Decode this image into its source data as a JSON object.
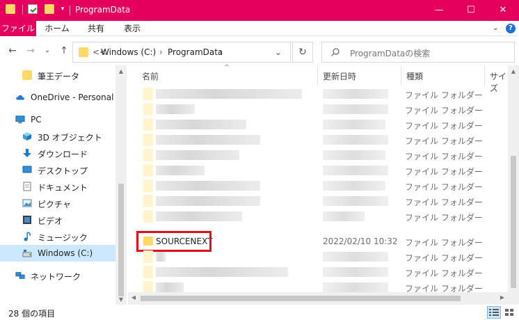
{
  "window": {
    "title": "ProgramData",
    "minimize": "—",
    "maximize": "☐",
    "close": "✕",
    "quick_access_dropdown": "▾"
  },
  "ribbon": {
    "tabs": [
      "ファイル",
      "ホーム",
      "共有",
      "表示"
    ],
    "expand": "⌄",
    "help": "?"
  },
  "address": {
    "back": "←",
    "forward": "→",
    "recent": "⌄",
    "up": "↑",
    "overflow": "<<",
    "segments": [
      "Windows (C:)",
      "ProgramData"
    ],
    "separator": "›",
    "dropdown": "⌄",
    "refresh": "↻"
  },
  "search": {
    "placeholder": "ProgramDataの検索"
  },
  "navpane": {
    "items": [
      {
        "label": "筆王データ",
        "icon": "folder-icon"
      },
      {
        "label": "OneDrive - Personal",
        "icon": "cloud-icon"
      },
      {
        "label": "PC",
        "icon": "computer-icon"
      },
      {
        "label": "3D オブジェクト",
        "icon": "cube-icon"
      },
      {
        "label": "ダウンロード",
        "icon": "download-icon"
      },
      {
        "label": "デスクトップ",
        "icon": "desktop-icon"
      },
      {
        "label": "ドキュメント",
        "icon": "document-icon"
      },
      {
        "label": "ピクチャ",
        "icon": "picture-icon"
      },
      {
        "label": "ビデオ",
        "icon": "video-icon"
      },
      {
        "label": "ミュージック",
        "icon": "music-icon"
      },
      {
        "label": "Windows (C:)",
        "icon": "drive-icon"
      },
      {
        "label": "ネットワーク",
        "icon": "network-icon"
      }
    ]
  },
  "columns": {
    "name": "名前",
    "date": "更新日時",
    "type": "種類",
    "size": "サイズ",
    "sort_indicator": "^"
  },
  "rows": [
    {
      "name": "",
      "date": "",
      "type": "ファイル フォルダー"
    },
    {
      "name": "",
      "date": "",
      "type": "ファイル フォルダー"
    },
    {
      "name": "",
      "date": "",
      "type": "ファイル フォルダー"
    },
    {
      "name": "",
      "date": "",
      "type": "ファイル フォルダー"
    },
    {
      "name": "",
      "date": "",
      "type": "ファイル フォルダー"
    },
    {
      "name": "",
      "date": "",
      "type": "ファイル フォルダー"
    },
    {
      "name": "",
      "date": "",
      "type": "ファイル フォルダー"
    },
    {
      "name": "",
      "date": "",
      "type": "ファイル フォルダー"
    },
    {
      "name": "",
      "date": "",
      "type": "ファイル フォルダー"
    },
    {
      "name": "SOURCENEXT",
      "date": "2022/02/10 10:32",
      "type": "ファイル フォルダー"
    },
    {
      "name": "",
      "date": "",
      "type": "ファイル フォルダー"
    },
    {
      "name": "",
      "date": "",
      "type": "ファイル フォルダー"
    },
    {
      "name": "",
      "date": "",
      "type": "ファイル フォルダー"
    }
  ],
  "status": {
    "item_count": "28 個の項目"
  },
  "colors": {
    "accent": "#e6005e",
    "highlight_box": "#e0101b",
    "folder": "#ffd866"
  }
}
